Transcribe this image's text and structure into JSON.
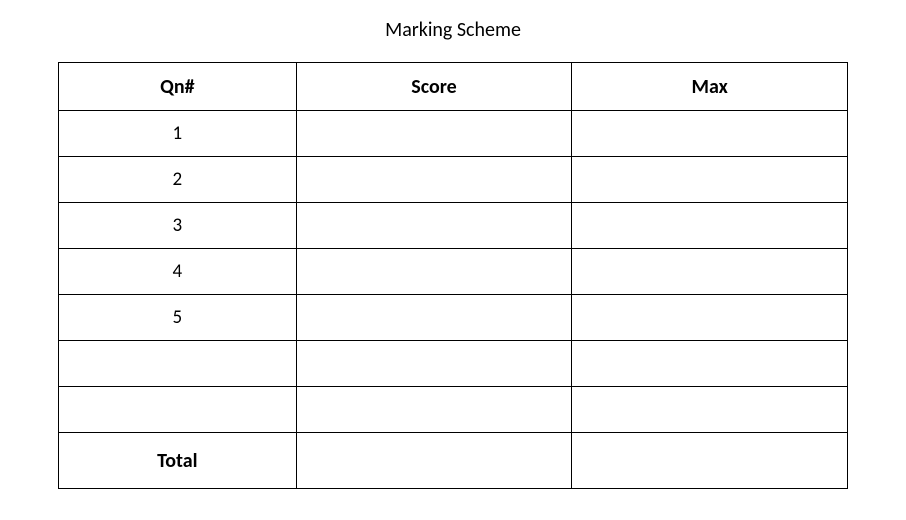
{
  "title": "Marking Scheme",
  "headers": {
    "qn": "Qn#",
    "score": "Score",
    "max": "Max"
  },
  "rows": [
    {
      "qn": "1",
      "score": "",
      "max": ""
    },
    {
      "qn": "2",
      "score": "",
      "max": ""
    },
    {
      "qn": "3",
      "score": "",
      "max": ""
    },
    {
      "qn": "4",
      "score": "",
      "max": ""
    },
    {
      "qn": "5",
      "score": "",
      "max": ""
    },
    {
      "qn": "",
      "score": "",
      "max": ""
    },
    {
      "qn": "",
      "score": "",
      "max": ""
    }
  ],
  "total": {
    "label": "Total",
    "score": "",
    "max": ""
  }
}
